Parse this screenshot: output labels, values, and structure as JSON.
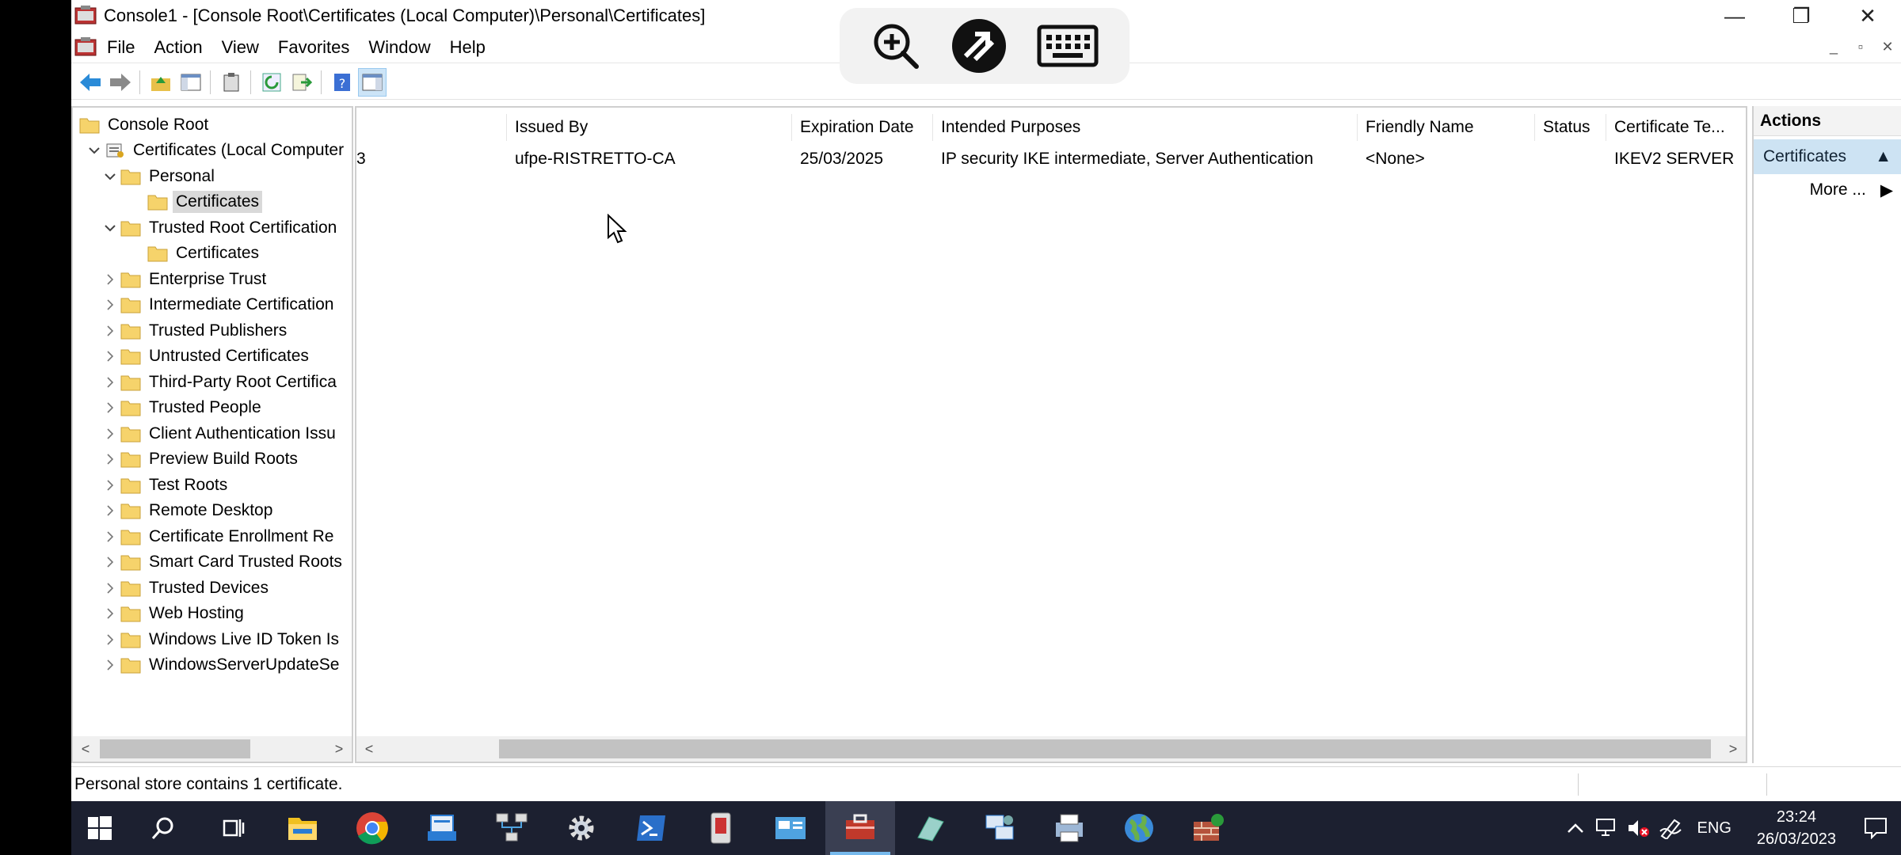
{
  "window": {
    "title": "Console1 - [Console Root\\Certificates (Local Computer)\\Personal\\Certificates]",
    "controls": {
      "minimize": "—",
      "restore": "❐",
      "close": "✕"
    }
  },
  "menu": [
    "File",
    "Action",
    "View",
    "Favorites",
    "Window",
    "Help"
  ],
  "tree": {
    "root": "Console Root",
    "items": [
      {
        "label": "Certificates (Local Computer",
        "level": 1,
        "expander": "down"
      },
      {
        "label": "Personal",
        "level": 2,
        "expander": "down"
      },
      {
        "label": "Certificates",
        "level": 3,
        "expander": "none",
        "selected": true
      },
      {
        "label": "Trusted Root Certification",
        "level": 2,
        "expander": "down"
      },
      {
        "label": "Certificates",
        "level": 3,
        "expander": "none"
      },
      {
        "label": "Enterprise Trust",
        "level": 2,
        "expander": "right"
      },
      {
        "label": "Intermediate Certification",
        "level": 2,
        "expander": "right"
      },
      {
        "label": "Trusted Publishers",
        "level": 2,
        "expander": "right"
      },
      {
        "label": "Untrusted Certificates",
        "level": 2,
        "expander": "right"
      },
      {
        "label": "Third-Party Root Certifica",
        "level": 2,
        "expander": "right"
      },
      {
        "label": "Trusted People",
        "level": 2,
        "expander": "right"
      },
      {
        "label": "Client Authentication Issu",
        "level": 2,
        "expander": "right"
      },
      {
        "label": "Preview Build Roots",
        "level": 2,
        "expander": "right"
      },
      {
        "label": "Test Roots",
        "level": 2,
        "expander": "right"
      },
      {
        "label": "Remote Desktop",
        "level": 2,
        "expander": "right"
      },
      {
        "label": "Certificate Enrollment Re",
        "level": 2,
        "expander": "right"
      },
      {
        "label": "Smart Card Trusted Roots",
        "level": 2,
        "expander": "right"
      },
      {
        "label": "Trusted Devices",
        "level": 2,
        "expander": "right"
      },
      {
        "label": "Web Hosting",
        "level": 2,
        "expander": "right"
      },
      {
        "label": "Windows Live ID Token Is",
        "level": 2,
        "expander": "right"
      },
      {
        "label": "WindowsServerUpdateSe",
        "level": 2,
        "expander": "right"
      }
    ]
  },
  "list": {
    "columns": [
      "",
      "Issued By",
      "Expiration Date",
      "Intended Purposes",
      "Friendly Name",
      "Status",
      "Certificate Te..."
    ],
    "rows": [
      [
        "3",
        "ufpe-RISTRETTO-CA",
        "25/03/2025",
        "IP security IKE intermediate, Server Authentication",
        "<None>",
        "",
        "IKEV2 SERVER"
      ]
    ]
  },
  "actions": {
    "header": "Actions",
    "section": "Certificates",
    "more": "More ..."
  },
  "status": "Personal store contains 1 certificate.",
  "tray": {
    "lang": "ENG",
    "time": "23:24",
    "date": "26/03/2023"
  },
  "colors": {
    "taskbar": "#1c2030",
    "accent": "#76b9ed",
    "selection": "#d9d9d9",
    "actions_highlight": "#cde3f3"
  }
}
